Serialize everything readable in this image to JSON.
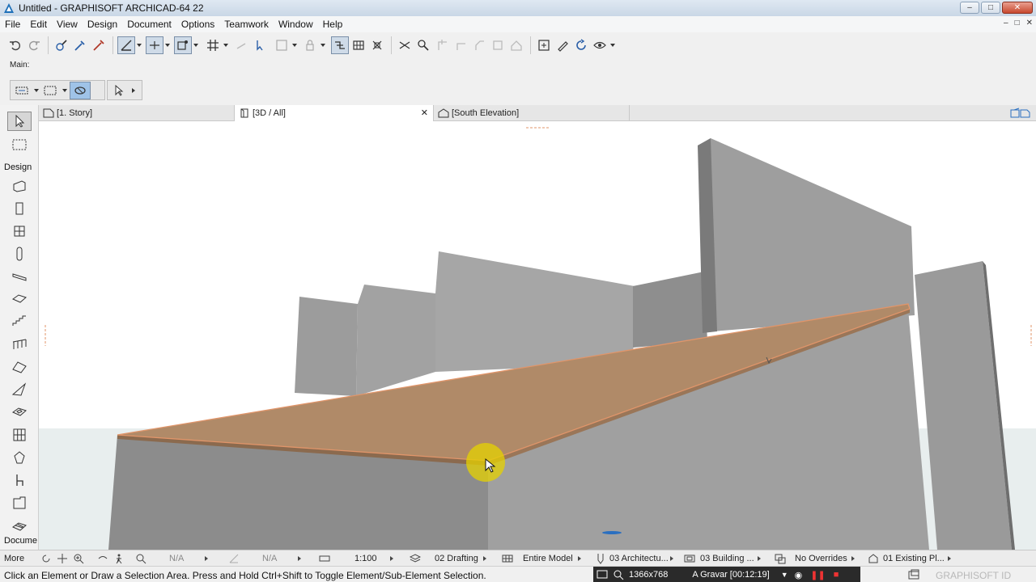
{
  "window": {
    "title": "Untitled - GRAPHISOFT ARCHICAD-64 22"
  },
  "menu": [
    "File",
    "Edit",
    "View",
    "Design",
    "Document",
    "Options",
    "Teamwork",
    "Window",
    "Help"
  ],
  "infobox": {
    "label": "Main:"
  },
  "tabs": [
    {
      "label": "[1. Story]"
    },
    {
      "label": "[3D / All]",
      "active": true
    },
    {
      "label": "[South Elevation]"
    }
  ],
  "toolbox": {
    "design_label": "Design",
    "document_label": "Docume",
    "more_label": "More"
  },
  "navbar": {
    "zoom_value": "N/A",
    "angle_value": "N/A",
    "scale": "1:100",
    "layer_combo": "02 Drafting",
    "model_filter": "Entire Model",
    "pen_set": "03 Architectu...",
    "model_view": "03 Building ...",
    "overrides": "No Overrides",
    "renovation": "01 Existing Pl..."
  },
  "status": {
    "message": "Click an Element or Draw a Selection Area. Press and Hold Ctrl+Shift to Toggle Element/Sub-Element Selection.",
    "resolution": "1366x768",
    "recorder": "A Gravar [00:12:19]",
    "graphisoft_id": "GRAPHISOFT ID"
  },
  "colors": {
    "slab": "#b08a68",
    "slab_edge": "#e0956a",
    "wall": "#9a9a9a",
    "cursor_highlight": "#e6d200"
  }
}
